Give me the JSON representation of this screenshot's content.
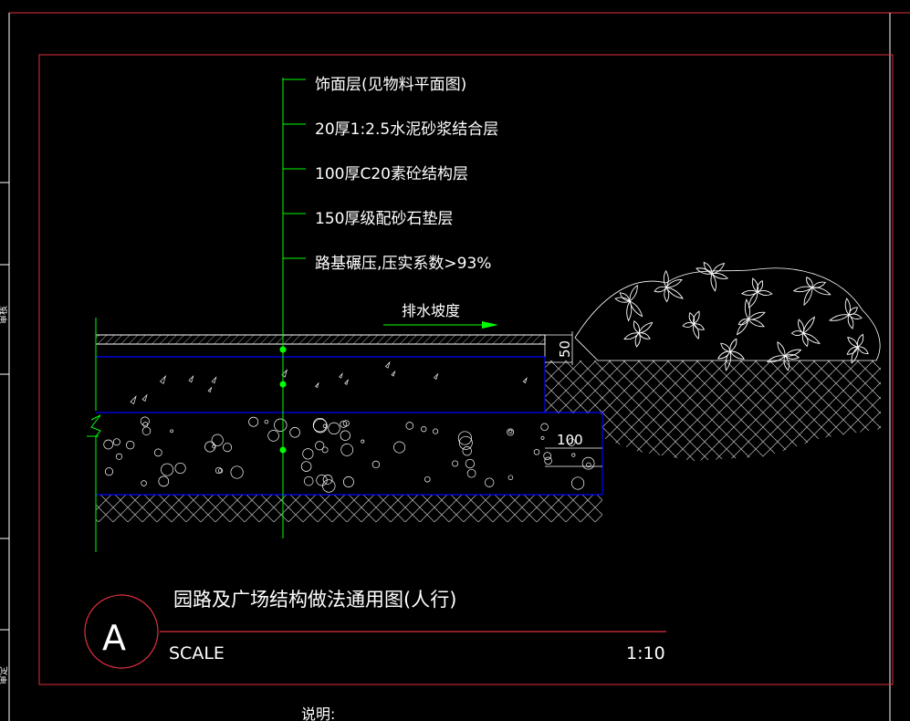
{
  "drawing": {
    "layers": [
      "饰面层(见物料平面图)",
      "20厚1:2.5水泥砂浆结合层",
      "100厚C20素砼结构层",
      "150厚级配砂石垫层",
      "路基碾压,压实系数>93%"
    ],
    "slope_label": "排水坡度",
    "dim_top": "50",
    "dim_side": "100",
    "title": "园路及广场结构做法通用图(人行)",
    "detail_letter": "A",
    "scale_label": "SCALE",
    "scale_value": "1:10",
    "note_label": "说明:",
    "left_edge_labels": [
      "审核",
      "审定"
    ]
  },
  "colors": {
    "background": "#000000",
    "frame": "#e0303f",
    "leader": "#00ff00",
    "layer_lines": "#0000ff",
    "linework": "#ffffff",
    "text": "#ffffff"
  }
}
